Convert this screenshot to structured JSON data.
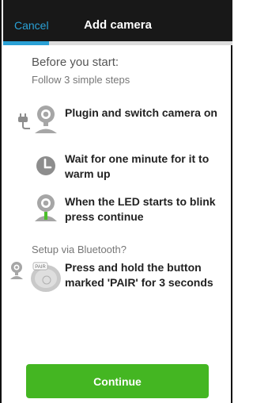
{
  "header": {
    "cancel_label": "Cancel",
    "title": "Add camera",
    "progress_fraction": 0.2
  },
  "intro": {
    "title": "Before you start:",
    "subtitle": "Follow 3 simple steps"
  },
  "steps": [
    {
      "icon": "plug-camera-icon",
      "text": "Plugin and switch camera on"
    },
    {
      "icon": "clock-icon",
      "text": "Wait for one minute for it to warm up"
    },
    {
      "icon": "camera-led-icon",
      "text": "When the LED starts to blink press continue"
    }
  ],
  "bluetooth": {
    "label": "Setup via Bluetooth?",
    "icon": "pair-button-icon",
    "pair_text": "PAIR",
    "text": "Press and hold the button marked 'PAIR' for 3 seconds"
  },
  "footer": {
    "continue_label": "Continue"
  },
  "colors": {
    "accent": "#2aa1d6",
    "button": "#44b622",
    "navbar": "#181818",
    "icon_gray": "#9a9a9a",
    "led_green": "#4cbf2b"
  }
}
